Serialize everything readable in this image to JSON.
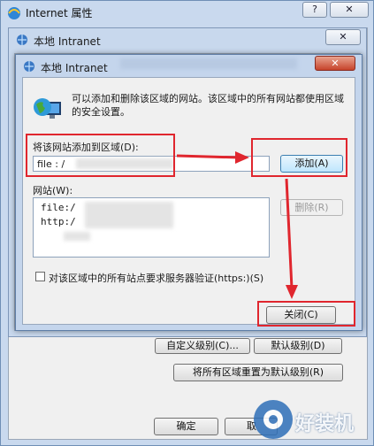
{
  "outer": {
    "title": "Internet 属性",
    "help": "?",
    "close": "✕",
    "ok": "确定",
    "cancel_partial": "取",
    "custom_level": "自定义级别(C)...",
    "default_level": "默认级别(D)",
    "reset_all": "将所有区域重置为默认级别(R)"
  },
  "middle": {
    "title": "本地 Intranet",
    "close": "✕"
  },
  "dialog": {
    "title": "本地 Intranet",
    "close": "✕",
    "info": "可以添加和删除该区域的网站。该区域中的所有网站都使用区域的安全设置。",
    "add_label": "将该网站添加到区域(D):",
    "add_value": "file : /",
    "add_button": "添加(A)",
    "sites_label": "网站(W):",
    "sites": [
      "file:/",
      "http:/"
    ],
    "remove_button": "删除(R)",
    "https_label": "对该区域中的所有站点要求服务器验证(https:)(S)",
    "close_button": "关闭(C)"
  },
  "watermark": "好装机",
  "colors": {
    "highlight": "#e0262e",
    "dialog_bg": "#f0f0f0",
    "title_bg": "#c4d5ec"
  }
}
